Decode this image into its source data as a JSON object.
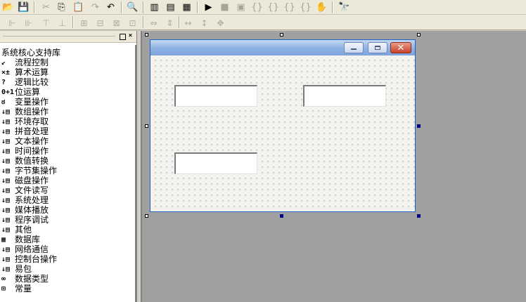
{
  "toolbar1": {
    "icons": [
      "open-icon",
      "save-icon",
      "cut-icon",
      "copy-icon",
      "paste-icon",
      "redo-icon",
      "undo-icon",
      "find-icon",
      "layout-left-icon",
      "layout-top-icon",
      "layout-bottom-icon",
      "run-icon",
      "stop-icon",
      "compile-icon",
      "step-in-icon",
      "step-over-icon",
      "step-out-icon",
      "run-to-cursor-icon",
      "hand-icon",
      "search-help-icon"
    ]
  },
  "toolbar2": {
    "icons": [
      "align-left-icon",
      "align-center-h-icon",
      "align-top-icon",
      "align-center-v-icon",
      "align-right-icon",
      "align-bottom-icon",
      "space-h-icon",
      "space-v-icon",
      "center-h-icon",
      "center-v-icon",
      "same-width-icon",
      "same-height-icon",
      "same-size-icon"
    ]
  },
  "panel": {
    "close_glyph": "×",
    "pin_glyph": "▫",
    "root_label": "系统核心支持库",
    "items": [
      {
        "label": "流程控制",
        "icon": "flow-control-icon",
        "glyph": "↙"
      },
      {
        "label": "算术运算",
        "icon": "arithmetic-icon",
        "glyph": "×±"
      },
      {
        "label": "逻辑比较",
        "icon": "logic-icon",
        "glyph": "?"
      },
      {
        "label": "位运算",
        "icon": "bit-icon",
        "glyph": "0+1"
      },
      {
        "label": "变量操作",
        "icon": "variable-icon",
        "glyph": "ಠ"
      },
      {
        "label": "数组操作",
        "icon": "module-icon",
        "glyph": "↓▤"
      },
      {
        "label": "环境存取",
        "icon": "module-icon",
        "glyph": "↓▤"
      },
      {
        "label": "拼音处理",
        "icon": "module-icon",
        "glyph": "↓▤"
      },
      {
        "label": "文本操作",
        "icon": "module-icon",
        "glyph": "↓▤"
      },
      {
        "label": "时间操作",
        "icon": "module-icon",
        "glyph": "↓▤"
      },
      {
        "label": "数值转换",
        "icon": "module-icon",
        "glyph": "↓▤"
      },
      {
        "label": "字节集操作",
        "icon": "module-icon",
        "glyph": "↓▤"
      },
      {
        "label": "磁盘操作",
        "icon": "module-icon",
        "glyph": "↓▤"
      },
      {
        "label": "文件读写",
        "icon": "module-icon",
        "glyph": "↓▤"
      },
      {
        "label": "系统处理",
        "icon": "module-icon",
        "glyph": "↓▤"
      },
      {
        "label": "媒体播放",
        "icon": "module-icon",
        "glyph": "↓▤"
      },
      {
        "label": "程序调试",
        "icon": "module-icon",
        "glyph": "↓▤"
      },
      {
        "label": "其他",
        "icon": "module-icon",
        "glyph": "↓▤"
      },
      {
        "label": "数据库",
        "icon": "database-icon",
        "glyph": "▦"
      },
      {
        "label": "网络通信",
        "icon": "module-icon",
        "glyph": "↓▤"
      },
      {
        "label": "控制台操作",
        "icon": "module-icon",
        "glyph": "↓▤"
      },
      {
        "label": "易包",
        "icon": "module-icon",
        "glyph": "↓▤"
      },
      {
        "label": "数据类型",
        "icon": "datatype-icon",
        "glyph": "∞"
      },
      {
        "label": "常量",
        "icon": "constant-icon",
        "glyph": "⊞"
      }
    ]
  },
  "form": {
    "min_glyph": "",
    "close_glyph": "✕"
  }
}
